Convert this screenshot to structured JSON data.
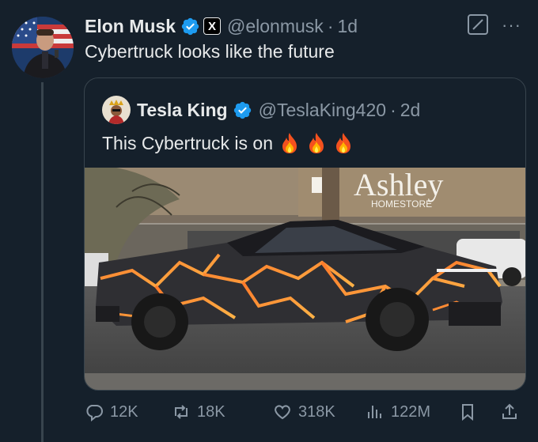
{
  "tweet": {
    "author_name": "Elon Musk",
    "author_handle": "@elonmusk",
    "time": "1d",
    "dot": "·",
    "badge_x": "X",
    "text": "Cybertruck looks like the future"
  },
  "quote": {
    "author_name": "Tesla King",
    "author_handle": "@TeslaKing420",
    "time": "2d",
    "dot": "·",
    "text": "This Cybertruck is on",
    "photo": {
      "store_sign": "Ashley",
      "store_sub": "HOMESTORE"
    }
  },
  "actions": {
    "replies": "12K",
    "reposts": "18K",
    "likes": "318K",
    "views": "122M"
  },
  "more": "···",
  "colors": {
    "background": "#15202b",
    "verified": "#1d9bf0",
    "muted": "#8b98a5",
    "text": "#e7e9ea",
    "border": "#38444d"
  },
  "icons": [
    "verified-icon",
    "x-badge-icon",
    "grok-icon",
    "more-icon",
    "fire-icon",
    "reply-icon",
    "repost-icon",
    "like-icon",
    "views-icon",
    "bookmark-icon",
    "share-icon"
  ]
}
